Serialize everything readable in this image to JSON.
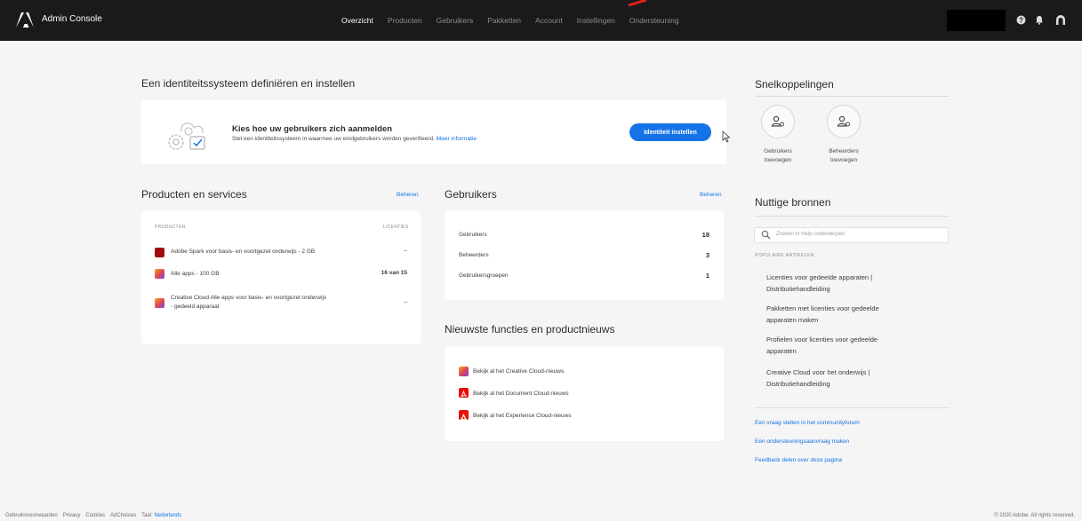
{
  "header": {
    "app_title": "Admin Console",
    "nav": [
      "Overzicht",
      "Producten",
      "Gebruikers",
      "Pakketten",
      "Account",
      "Instellingen",
      "Ondersteuning"
    ],
    "active_nav": "Overzicht",
    "icons": [
      "help-icon",
      "bell-icon",
      "user-profile-icon"
    ]
  },
  "identity": {
    "heading": "Een identiteitssysteem definiëren en instellen",
    "title": "Kies hoe uw gebruikers zich aanmelden",
    "description": "Stel een identiteitssysteem in waarmee uw eindgebruikers worden geverifieerd.",
    "more_link": "Meer informatie",
    "button": "Identiteit instellen"
  },
  "products": {
    "heading": "Producten en services",
    "manage": "Beheren",
    "col_products": "PRODUCTEN",
    "col_licenses": "LICENTIES",
    "rows": [
      {
        "name": "Adobe Spark voor basis- en voortgezet onderwijs - 2 GB",
        "licenses": "–",
        "icon_color": "#a30c0c"
      },
      {
        "name": "Alle apps - 100 GB",
        "licenses": "16 van 15",
        "icon_color": "#e34850"
      },
      {
        "name_line1": "Creative Cloud Alle apps voor basis- en voortgezet onderwijs",
        "name_line2": "- gedeeld apparaat",
        "licenses": "–",
        "icon_color": "#e34850"
      }
    ]
  },
  "users": {
    "heading": "Gebruikers",
    "manage": "Beheren",
    "rows": [
      {
        "label": "Gebruikers",
        "value": "18"
      },
      {
        "label": "Beheerders",
        "value": "3"
      },
      {
        "label": "Gebruikersgroepen",
        "value": "1"
      }
    ]
  },
  "news": {
    "heading": "Nieuwste functies en productnieuws",
    "items": [
      {
        "text": "Bekijk al het Creative Cloud-nieuws",
        "icon": "creative-cloud-icon"
      },
      {
        "text": "Bekijk al het Document Cloud-nieuws",
        "icon": "document-cloud-icon"
      },
      {
        "text": "Bekijk al het Experience Cloud-nieuws",
        "icon": "experience-cloud-icon"
      }
    ]
  },
  "shortcuts": {
    "heading": "Snelkoppelingen",
    "items": [
      {
        "line1": "Gebruikers",
        "line2": "toevoegen"
      },
      {
        "line1": "Beheerders",
        "line2": "toevoegen"
      }
    ]
  },
  "resources": {
    "heading": "Nuttige bronnen",
    "search_placeholder": "Zoeken in Help-onderwerpen",
    "popular_heading": "POPULAIRE ARTIKELEN",
    "articles": [
      {
        "line1": "Licenties voor gedeelde apparaten |",
        "line2": "Distributiehandleiding"
      },
      {
        "line1": "Pakketten met licenties voor gedeelde",
        "line2": "apparaten maken"
      },
      {
        "line1": "Profielen voor licenties voor gedeelde",
        "line2": "apparaten"
      },
      {
        "line1": "Creative Cloud voor het onderwijs |",
        "line2": "Distributiehandleiding"
      }
    ],
    "links": [
      "Een vraag stellen in het communityforum",
      "Een ondersteuningsaanvraag maken",
      "Feedback delen over deze pagina"
    ]
  },
  "footer": {
    "links": [
      "Gebruiksvoorwaarden",
      "Privacy",
      "Cookies",
      "AdChoices"
    ],
    "lang_label": "Taal:",
    "lang_value": "Nederlands",
    "copyright": "© 2020 Adobe. All rights reserved."
  },
  "colors": {
    "accent": "#1473e6",
    "topbar": "#1a1a1a",
    "background": "#f5f5f5"
  }
}
